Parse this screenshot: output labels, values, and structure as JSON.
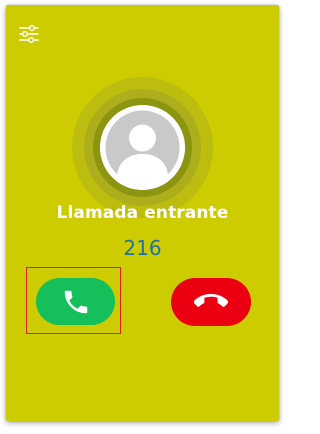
{
  "call": {
    "status": "Llamada entrante",
    "caller_number": "216"
  },
  "icons": {
    "settings": "sliders-icon",
    "avatar": "person-silhouette-icon",
    "accept": "phone-icon",
    "decline": "phone-hangup-icon"
  },
  "colors": {
    "background": "#cccc00",
    "accept": "#15c05a",
    "decline": "#ea0010",
    "number": "#1d72a8",
    "focus_outline": "#e0201c"
  }
}
